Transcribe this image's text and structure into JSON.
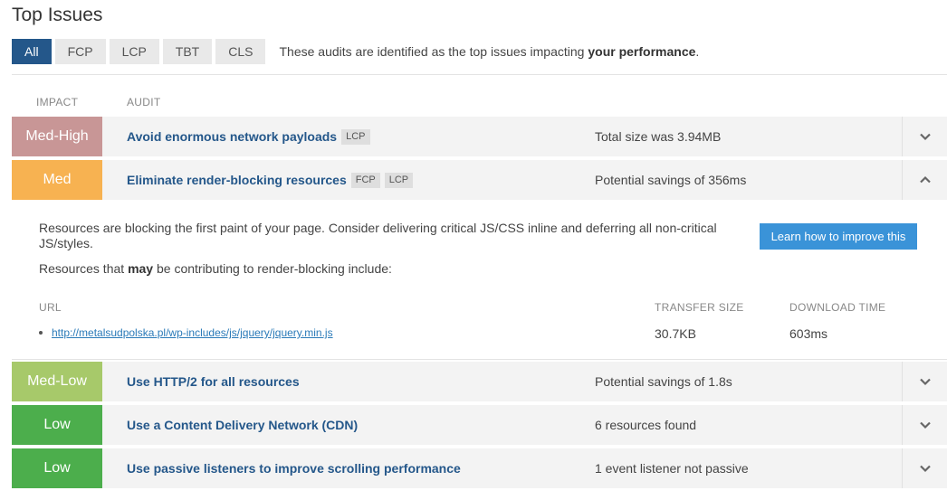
{
  "page": {
    "title": "Top Issues"
  },
  "filters": {
    "tabs": [
      {
        "label": "All",
        "active": true
      },
      {
        "label": "FCP",
        "active": false
      },
      {
        "label": "LCP",
        "active": false
      },
      {
        "label": "TBT",
        "active": false
      },
      {
        "label": "CLS",
        "active": false
      }
    ],
    "desc_prefix": "These audits are identified as the top issues impacting ",
    "desc_bold": "your performance",
    "desc_suffix": "."
  },
  "table": {
    "headers": {
      "impact": "IMPACT",
      "audit": "AUDIT"
    },
    "rows": [
      {
        "impact": "Med-High",
        "impact_color": "#c89696",
        "title": "Avoid enormous network payloads",
        "tags": [
          "LCP"
        ],
        "value": "Total size was 3.94MB",
        "expanded": false,
        "toggle_icon": "chevron-down-icon"
      },
      {
        "impact": "Med",
        "impact_color": "#f7b251",
        "title": "Eliminate render-blocking resources",
        "tags": [
          "FCP",
          "LCP"
        ],
        "value": "Potential savings of 356ms",
        "expanded": true,
        "toggle_icon": "chevron-up-icon"
      },
      {
        "impact": "Med-Low",
        "impact_color": "#a7c96a",
        "title": "Use HTTP/2 for all resources",
        "tags": [],
        "value": "Potential savings of 1.8s",
        "expanded": false,
        "toggle_icon": "chevron-down-icon"
      },
      {
        "impact": "Low",
        "impact_color": "#4cae4c",
        "title": "Use a Content Delivery Network (CDN)",
        "tags": [],
        "value": "6 resources found",
        "expanded": false,
        "toggle_icon": "chevron-down-icon"
      },
      {
        "impact": "Low",
        "impact_color": "#4cae4c",
        "title": "Use passive listeners to improve scrolling performance",
        "tags": [],
        "value": "1 event listener not passive",
        "expanded": false,
        "toggle_icon": "chevron-down-icon"
      }
    ]
  },
  "detail": {
    "description": "Resources are blocking the first paint of your page. Consider delivering critical JS/CSS inline and deferring all non-critical JS/styles.",
    "sub_prefix": "Resources that ",
    "sub_bold": "may",
    "sub_suffix": " be contributing to render-blocking include:",
    "learn_button": "Learn how to improve this",
    "headers": {
      "url": "URL",
      "transfer_size": "TRANSFER SIZE",
      "download_time": "DOWNLOAD TIME"
    },
    "resources": [
      {
        "url": "http://metalsudpolska.pl/wp-includes/js/jquery/jquery.min.js",
        "transfer_size": "30.7KB",
        "download_time": "603ms"
      }
    ]
  }
}
